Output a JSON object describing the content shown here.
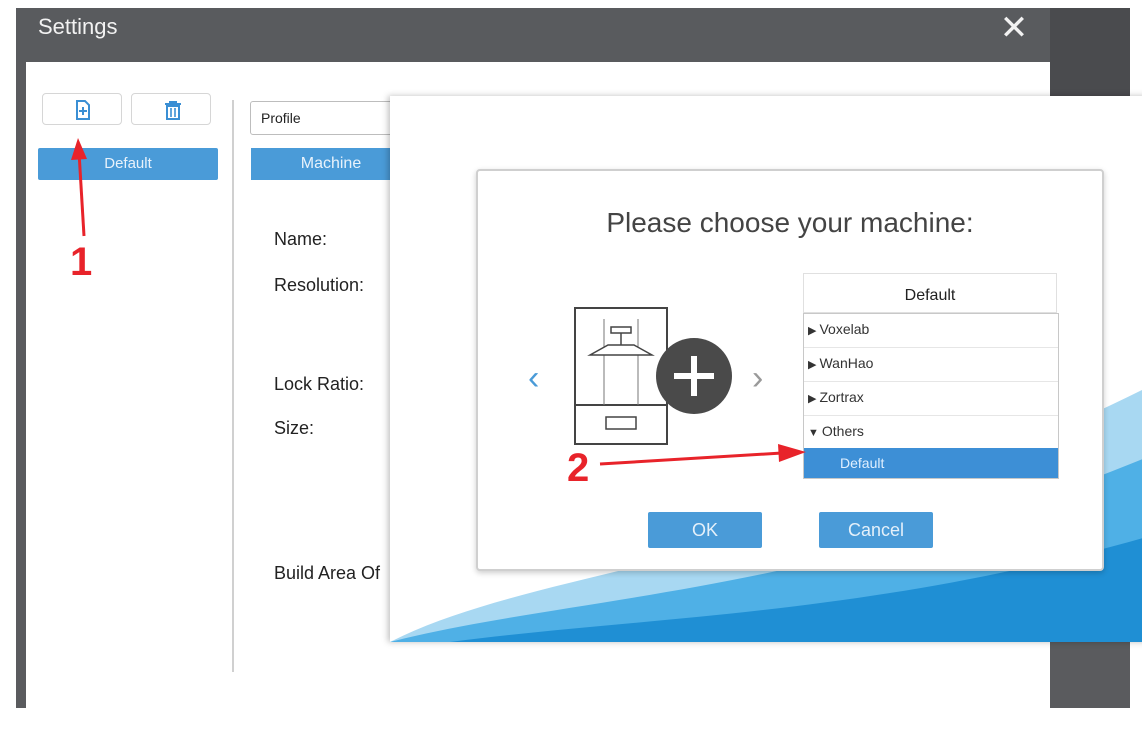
{
  "settings": {
    "title": "Settings",
    "close_icon": "close-icon",
    "toolbar": {
      "add_icon": "add-profile-icon",
      "delete_icon": "trash-icon"
    },
    "profile_list": {
      "selected": "Default"
    },
    "profile_select": {
      "value": "Profile"
    },
    "tab": {
      "label": "Machine"
    },
    "fields": {
      "name_label": "Name:",
      "resolution_label": "Resolution:",
      "lock_ratio_label": "Lock Ratio:",
      "size_label": "Size:",
      "build_area_label": "Build Area Of"
    }
  },
  "wizard": {
    "title": "Please choose your machine:",
    "prev_icon": "chevron-left-icon",
    "next_icon": "chevron-right-icon",
    "illustration_icon": "printer-add-icon",
    "tree": {
      "header": "Default",
      "items": [
        {
          "label": "Voxelab",
          "expanded": false
        },
        {
          "label": "WanHao",
          "expanded": false
        },
        {
          "label": "Zortrax",
          "expanded": false
        },
        {
          "label": "Others",
          "expanded": true
        },
        {
          "label": "Default",
          "selected": true
        }
      ]
    },
    "ok_label": "OK",
    "cancel_label": "Cancel"
  },
  "annotations": {
    "step1": "1",
    "step2": "2",
    "color": "#e8232a"
  },
  "colors": {
    "accent": "#4a9bd8",
    "titlebar": "#595b5e",
    "selected": "#3d8fd6"
  }
}
